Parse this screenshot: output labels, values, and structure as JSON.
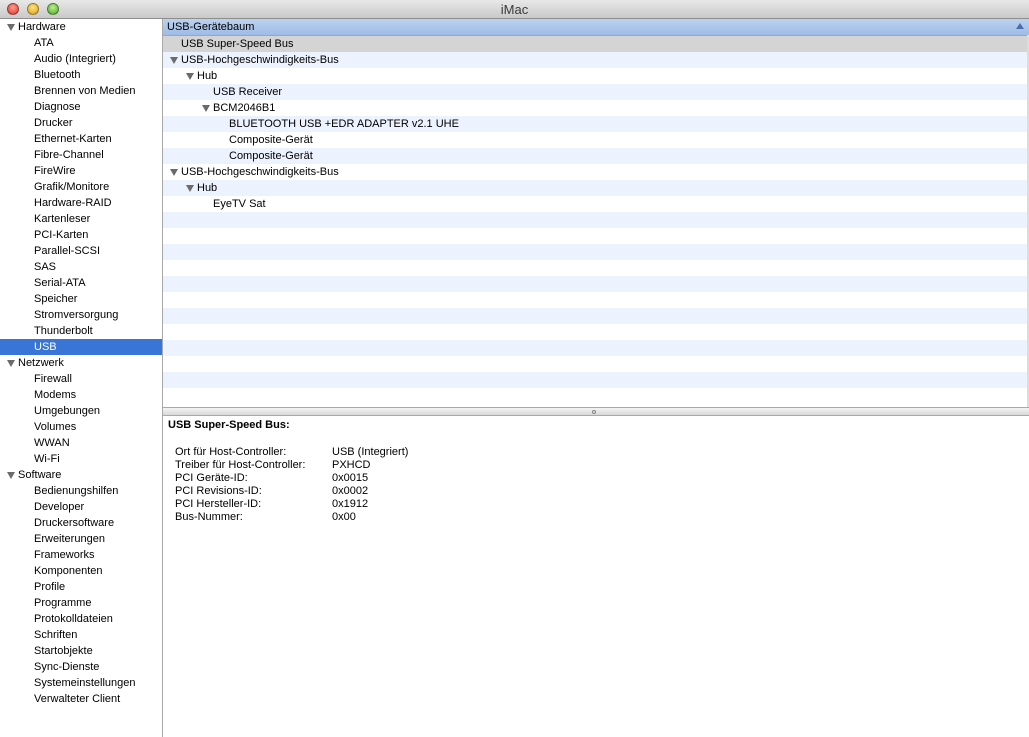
{
  "window": {
    "title": "iMac"
  },
  "sidebar": {
    "groups": [
      {
        "label": "Hardware",
        "items": [
          "ATA",
          "Audio (Integriert)",
          "Bluetooth",
          "Brennen von Medien",
          "Diagnose",
          "Drucker",
          "Ethernet-Karten",
          "Fibre-Channel",
          "FireWire",
          "Grafik/Monitore",
          "Hardware-RAID",
          "Kartenleser",
          "PCI-Karten",
          "Parallel-SCSI",
          "SAS",
          "Serial-ATA",
          "Speicher",
          "Stromversorgung",
          "Thunderbolt",
          "USB"
        ]
      },
      {
        "label": "Netzwerk",
        "items": [
          "Firewall",
          "Modems",
          "Umgebungen",
          "Volumes",
          "WWAN",
          "Wi-Fi"
        ]
      },
      {
        "label": "Software",
        "items": [
          "Bedienungshilfen",
          "Developer",
          "Druckersoftware",
          "Erweiterungen",
          "Frameworks",
          "Komponenten",
          "Profile",
          "Programme",
          "Protokolldateien",
          "Schriften",
          "Startobjekte",
          "Sync-Dienste",
          "Systemeinstellungen",
          "Verwalteter Client"
        ]
      }
    ],
    "selected": "USB"
  },
  "tree": {
    "header": "USB-Gerätebaum",
    "rows": [
      {
        "label": "USB Super-Speed Bus",
        "depth": 0,
        "expanded": false,
        "selected": true
      },
      {
        "label": "USB-Hochgeschwindigkeits-Bus",
        "depth": 0,
        "expanded": true
      },
      {
        "label": "Hub",
        "depth": 1,
        "expanded": true
      },
      {
        "label": "USB Receiver",
        "depth": 2
      },
      {
        "label": "BCM2046B1",
        "depth": 2,
        "expanded": true
      },
      {
        "label": "BLUETOOTH USB +EDR ADAPTER v2.1 UHE",
        "depth": 3
      },
      {
        "label": "Composite-Gerät",
        "depth": 3
      },
      {
        "label": "Composite-Gerät",
        "depth": 3
      },
      {
        "label": "USB-Hochgeschwindigkeits-Bus",
        "depth": 0,
        "expanded": true
      },
      {
        "label": "Hub",
        "depth": 1,
        "expanded": true
      },
      {
        "label": "EyeTV Sat",
        "depth": 2
      }
    ]
  },
  "detail": {
    "title": "USB Super-Speed Bus:",
    "properties": [
      {
        "key": "Ort für Host-Controller:",
        "value": "USB (Integriert)"
      },
      {
        "key": "Treiber für Host-Controller:",
        "value": "PXHCD"
      },
      {
        "key": "PCI Geräte-ID:",
        "value": "0x0015"
      },
      {
        "key": "PCI Revisions-ID:",
        "value": "0x0002"
      },
      {
        "key": "PCI Hersteller-ID:",
        "value": "0x1912"
      },
      {
        "key": "Bus-Nummer:",
        "value": "0x00"
      }
    ]
  },
  "colors": {
    "selection": "#3875d7",
    "row_stripe": "#edf3fe",
    "header": "#9fbbe6"
  }
}
